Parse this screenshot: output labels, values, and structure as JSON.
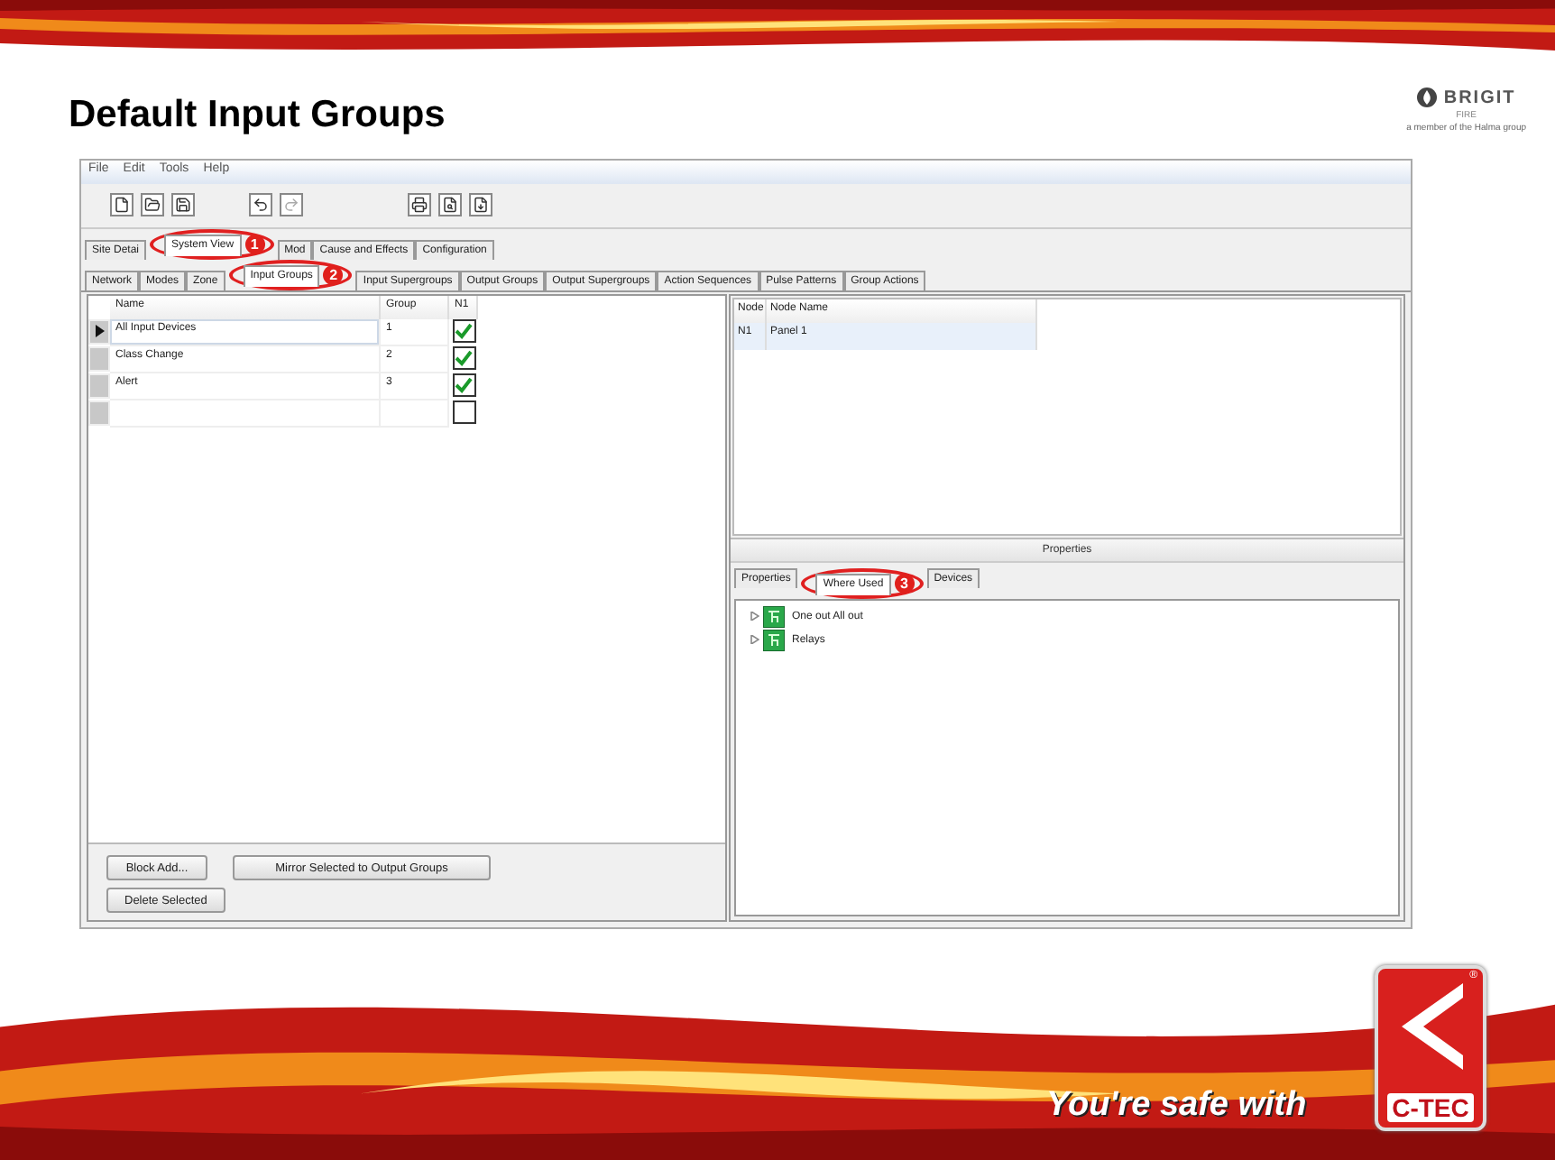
{
  "slide": {
    "title": "Default Input Groups",
    "brand": {
      "name": "BRIGIT",
      "sub": "FIRE",
      "tagline": "a member of the Halma group"
    },
    "footer": {
      "slogan": "You're safe with",
      "logo": "C-TEC",
      "mark": "®"
    }
  },
  "menu": [
    "File",
    "Edit",
    "Tools",
    "Help"
  ],
  "tabs": [
    {
      "label": "Site Detai",
      "selected": false
    },
    {
      "label": "System View",
      "selected": true,
      "callout": "1"
    },
    {
      "label": "Mod",
      "selected": false
    },
    {
      "label": "Cause and Effects",
      "selected": false
    },
    {
      "label": "Configuration",
      "selected": false
    }
  ],
  "subtabs": [
    {
      "label": "Network",
      "selected": false
    },
    {
      "label": "Modes",
      "selected": false
    },
    {
      "label": "Zone",
      "selected": false
    },
    {
      "label": "Input Groups",
      "selected": true,
      "callout": "2"
    },
    {
      "label": "Input Supergroups",
      "selected": false
    },
    {
      "label": "Output Groups",
      "selected": false
    },
    {
      "label": "Output Supergroups",
      "selected": false
    },
    {
      "label": "Action Sequences",
      "selected": false
    },
    {
      "label": "Pulse Patterns",
      "selected": false
    },
    {
      "label": "Group Actions",
      "selected": false
    }
  ],
  "table": {
    "columns": [
      "Name",
      "Group",
      "N1"
    ],
    "rows": [
      {
        "name": "All Input Devices",
        "group": "1",
        "n1": true,
        "selected": true
      },
      {
        "name": "Class Change",
        "group": "2",
        "n1": true,
        "selected": false
      },
      {
        "name": "Alert",
        "group": "3",
        "n1": true,
        "selected": false
      },
      {
        "n1": false,
        "selected": false
      }
    ]
  },
  "buttons": [
    [
      "Block Add...",
      "Mirror Selected to Output Groups"
    ],
    [
      "Delete Selected"
    ]
  ],
  "nodes": {
    "columns": [
      "Node",
      "Node Name"
    ],
    "rows": [
      {
        "node": "N1",
        "name": "Panel 1"
      }
    ]
  },
  "properties": {
    "title": "Properties",
    "tabs": [
      {
        "label": "Properties",
        "selected": false
      },
      {
        "label": "Where Used",
        "selected": true,
        "callout": "3"
      },
      {
        "label": "Devices",
        "selected": false
      }
    ],
    "tree": [
      {
        "label": "One out All out",
        "expanded": false
      },
      {
        "label": "Relays",
        "expanded": false
      }
    ]
  }
}
